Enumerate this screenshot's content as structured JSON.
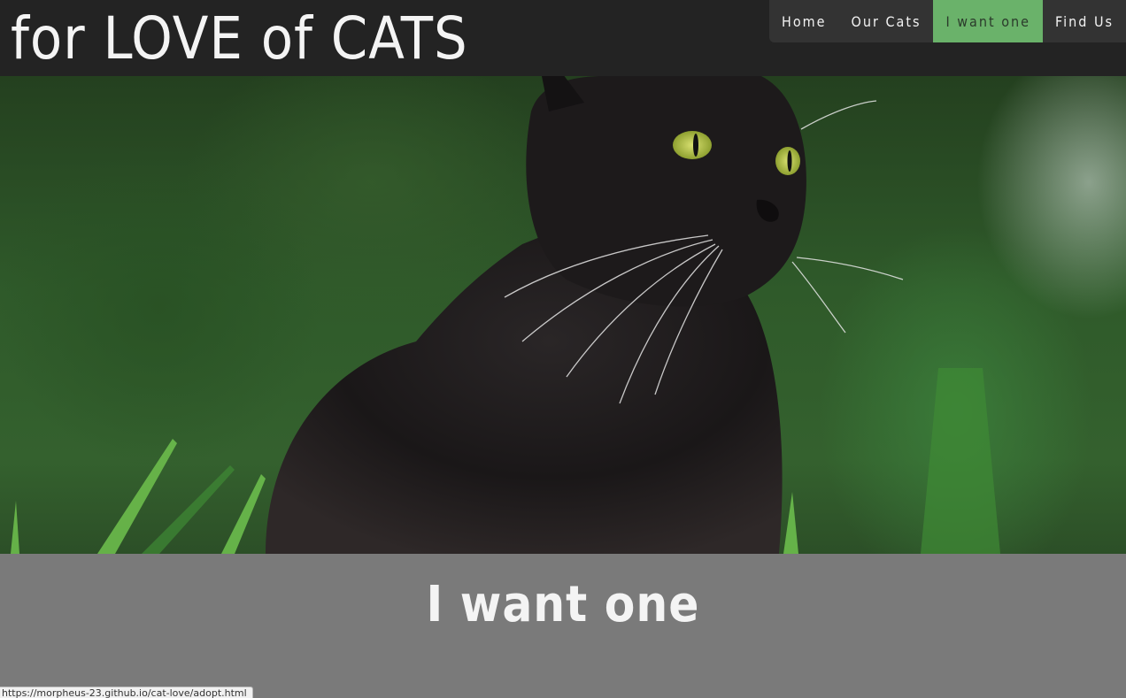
{
  "site": {
    "brand": "for LOVE of CATS"
  },
  "nav": {
    "items": [
      {
        "label": "Home",
        "active": false
      },
      {
        "label": "Our Cats",
        "active": false
      },
      {
        "label": "I want one",
        "active": true
      },
      {
        "label": "Find Us",
        "active": false
      }
    ]
  },
  "hero": {
    "image": "black-cat-in-grass"
  },
  "section": {
    "title": "I want one"
  },
  "status_bar": {
    "url": "https://morpheus-23.github.io/cat-love/adopt.html"
  },
  "colors": {
    "header_bg": "#232323",
    "nav_bg": "#333333",
    "nav_active": "#6ab26a",
    "section_bg": "#7a7a7a",
    "text": "#f4f4f4"
  }
}
